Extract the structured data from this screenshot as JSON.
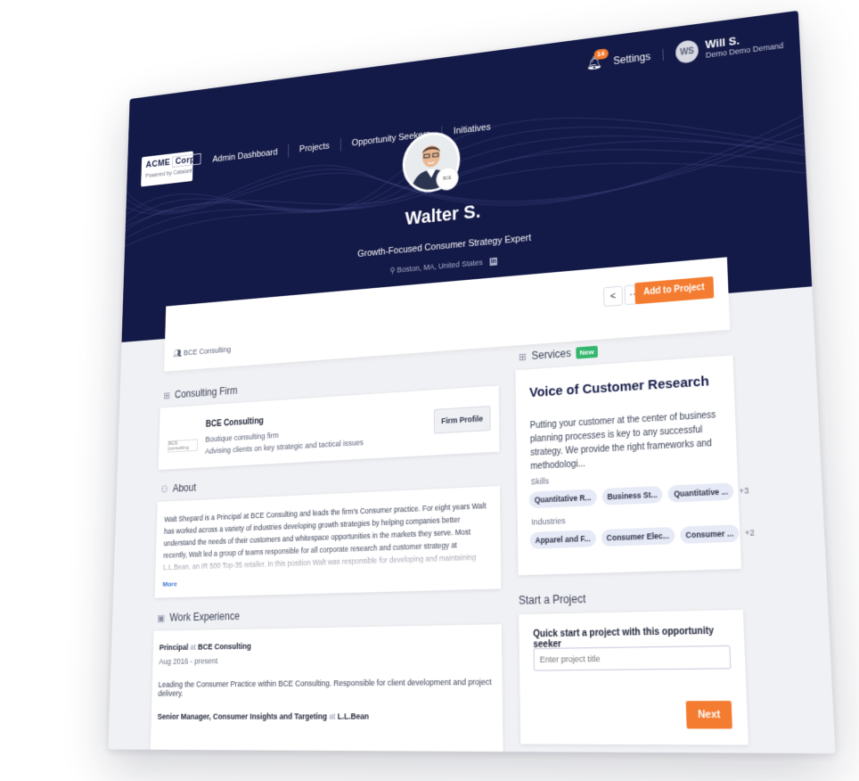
{
  "brand": {
    "name": "ACME",
    "name_suffix": "Corp.",
    "powered_by": "Powered by Catalant"
  },
  "nav": [
    {
      "label": "Admin Dashboard"
    },
    {
      "label": "Projects"
    },
    {
      "label": "Opportunity Seekers"
    },
    {
      "label": "Initiatives"
    }
  ],
  "header": {
    "notification_count": "14",
    "settings_label": "Settings",
    "user_initials": "WS",
    "user_name": "Will S.",
    "user_org": "Demo Demo Demand"
  },
  "profile": {
    "name": "Walter S.",
    "headline": "Growth-Focused Consumer Strategy Expert",
    "location": "Boston, MA, United States",
    "linkedin_glyph": "in",
    "firm_tag": "BCE Consulting"
  },
  "actions": {
    "share_icon": "share-icon",
    "more_label": "···",
    "add_to_project": "Add to Project"
  },
  "consulting_firm": {
    "heading": "Consulting Firm",
    "name": "BCE Consulting",
    "type": "Boutique consulting firm",
    "tagline": "Advising clients on key strategic and tactical issues",
    "button": "Firm Profile"
  },
  "about": {
    "heading": "About",
    "text": "Walt Shepard is a Principal at BCE Consulting and leads the firm's Consumer practice. For eight years Walt has worked across a variety of industries developing growth strategies by helping companies better understand the needs of their customers and whitespace opportunities in the markets they serve. Most recently, Walt led a group of teams responsible for all corporate research and customer strategy at L.L.Bean, an IR 500 Top-35 retailer. In this position Walt was responsible for developing and maintaining L.L.Bean's omnichannel voice-of-customer program.",
    "more": "More"
  },
  "work_experience": {
    "heading": "Work Experience",
    "items": [
      {
        "role": "Principal",
        "at": "at",
        "company": "BCE Consulting",
        "dates": "Aug 2016  - present",
        "description": "Leading the Consumer Practice within BCE Consulting. Responsible for client development and project delivery."
      },
      {
        "role": "Senior Manager, Consumer Insights and Targeting",
        "at": "at",
        "company": "L.L.Bean"
      }
    ]
  },
  "services": {
    "heading": "Services",
    "badge": "New",
    "title": "Voice of Customer Research",
    "description": "Putting your customer at the center of business planning processes is key to any successful strategy. We provide the right frameworks and methodologi...",
    "skills_label": "Skills",
    "skills": [
      "Quantitative R...",
      "Business St...",
      "Quantitative ..."
    ],
    "skills_more": "+3",
    "industries_label": "Industries",
    "industries": [
      "Apparel and F...",
      "Consumer Elec...",
      "Consumer ..."
    ],
    "industries_more": "+2"
  },
  "start_project": {
    "heading": "Start a Project",
    "label": "Quick start a project with this opportunity seeker",
    "placeholder": "Enter project title",
    "next": "Next"
  },
  "colors": {
    "navy": "#141a47",
    "accent": "#f47c30",
    "new_badge": "#33b66e",
    "link": "#3b73d6"
  }
}
